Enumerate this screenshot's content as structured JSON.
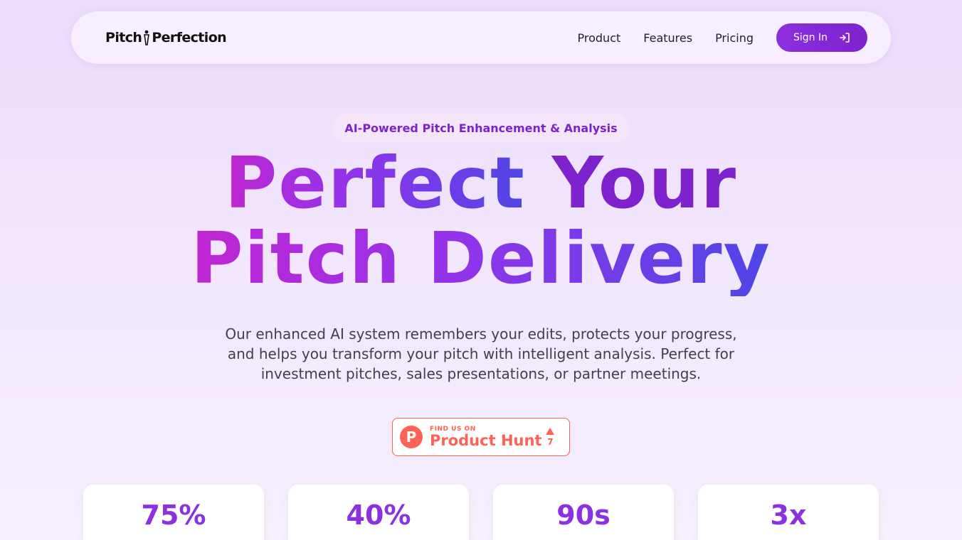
{
  "nav": {
    "logo_left": "Pitch",
    "logo_right": "Perfection",
    "links": [
      "Product",
      "Features",
      "Pricing"
    ],
    "signin_label": "Sign In"
  },
  "hero": {
    "badge": "AI-Powered Pitch Enhancement & Analysis",
    "headline_line1_part1": "Perfect",
    "headline_line1_part2": "Your",
    "headline_line2": "Pitch Delivery",
    "subtitle": "Our enhanced AI system remembers your edits, protects your progress, and helps you transform your pitch with intelligent analysis. Perfect for investment pitches, sales presentations, or partner meetings."
  },
  "product_hunt": {
    "logo_letter": "P",
    "small_text": "FIND US ON",
    "big_text": "Product Hunt",
    "votes": "7"
  },
  "stats": [
    {
      "value": "75%"
    },
    {
      "value": "40%"
    },
    {
      "value": "90s"
    },
    {
      "value": "3x"
    }
  ],
  "colors": {
    "accent": "#8b2fe0",
    "product_hunt": "#ff6154"
  }
}
